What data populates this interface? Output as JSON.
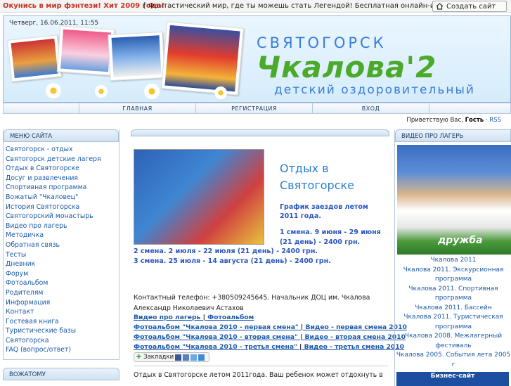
{
  "topbar": {
    "ad_link": "Окунись в мир фэнтези! Хит 2009 года!",
    "ad_text": "[ Фантастический мир, где ты можешь стать Легендой! Бесплатная онлайн-игра! ]",
    "create_site": "Создать сайт"
  },
  "header": {
    "date": "Четверг, 16.06.2011, 11:55",
    "city": "СВЯТОГОРСК",
    "camp": "Чкалова'2",
    "subtitle": "детский оздоровительный"
  },
  "nav": {
    "items": [
      "",
      "ГЛАВНАЯ",
      "РЕГИСТРАЦИЯ",
      "ВХОД",
      ""
    ]
  },
  "greeting": {
    "prefix": "Приветствую Вас,",
    "user": "Гость",
    "rss": "RSS"
  },
  "left": {
    "menu_title": "МЕНЮ САЙТА",
    "items": [
      "Святогорск - отдых",
      "Святогорск детские лагеря",
      "Отдых в Святогорске",
      "Досуг и развлечения",
      "Спортивная программа",
      "Вожатый \"Чкаловец\"",
      "История Святогорска",
      "Святогорский монастырь",
      "Видео про лагерь",
      "Методичка",
      "Обратная связь",
      "Тесты",
      "Дневник",
      "Форум",
      "Фотоальбом",
      "Родителям",
      "Информация",
      "Контакт",
      "Гостевая книга",
      "Туристические базы Святогорска",
      "FAQ (вопрос/ответ)"
    ],
    "second_title": "ВОЖАТОМУ"
  },
  "main": {
    "title": "Отдых в Святогорске",
    "schedule_title": "График заездов летом 2011 года.",
    "shift1": "1 смена. 9 июня - 29 июня (21 день) - 2400 грн.",
    "shift2": "2 смена. 2 июля - 22 июля (21 день) - 2400 грн.",
    "shift3": "3 смена. 25 июля - 14 августа (21 день) - 2400 грн.",
    "contact": "Контактный телефон: +380509245645. Начальник ДОЦ им. Чкалова Александр Николаевич Астахов",
    "links": {
      "video_about": "Видео про лагерь",
      "photoalbum": "Фотоальбом",
      "photo1": "Фотоальбом \"Чкалова 2010 - первая смена\"",
      "video1": "Видео - первая смена 2010",
      "photo2": "Фотоальбом \"Чкалова 2010 -  вторая смена\"",
      "video2": "Видео - вторая смена 2010",
      "photo3": "Фотоальбом \"Чкалова 2010 -  третья смена\"",
      "video3": "Видео - третья смена 2010"
    },
    "bookmarks": "Закладки",
    "intro": "Отдых в Святогорске летом  2011года. Ваш ребенок может отдохнуть в"
  },
  "right": {
    "title": "ВИДЕО ПРО ЛАГЕРЬ",
    "photo_caption": "дружба",
    "links": [
      "Чкалова 2011",
      "Чкалова 2011. Экскурсионная программа",
      "Чкалова 2011. Спортивная программа",
      "Чкалова 2011. Бассейн",
      "Чкалова 2011. Туристическая программа",
      "Чкалова 2008. Межлагерный фестиваль",
      "Чкалова 2005. События лета 2005 г"
    ],
    "biz": "Бизнес-сайт"
  },
  "colors": {
    "accent_blue": "#2a7dd8",
    "accent_green": "#4caa2a",
    "ad_red": "#c8321e",
    "link_blue": "#1a5aa8"
  }
}
